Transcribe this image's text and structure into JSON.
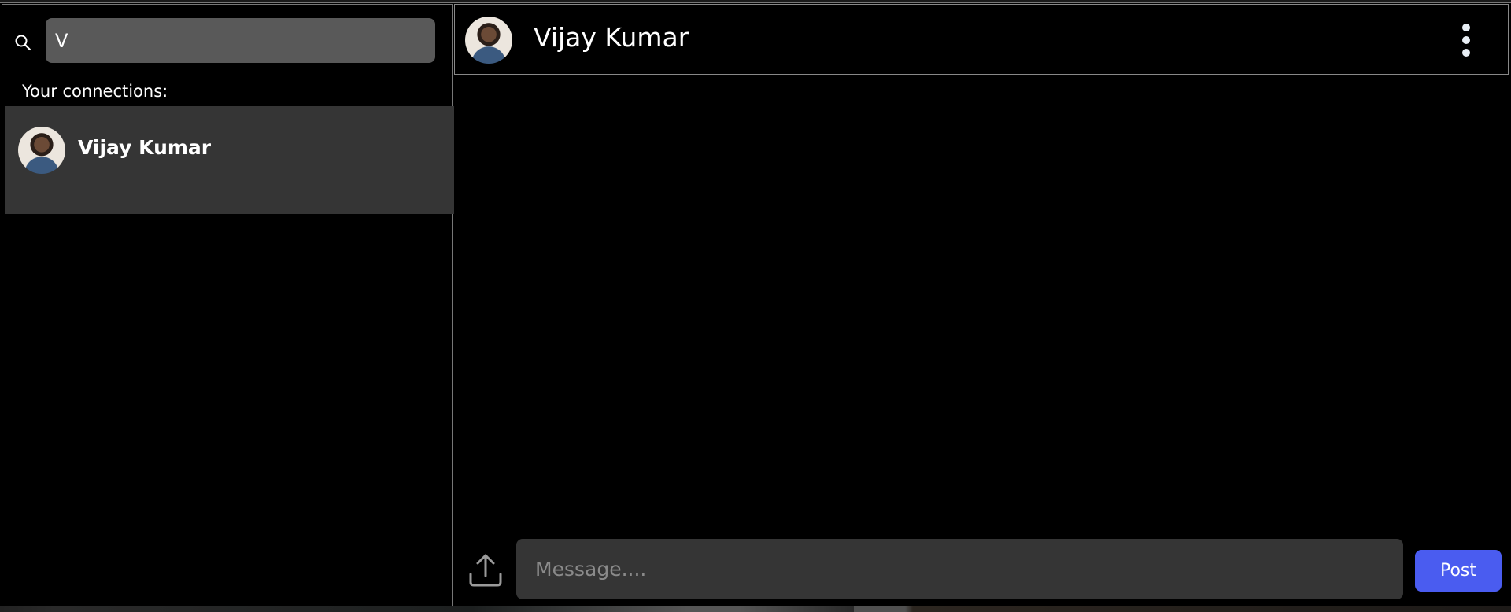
{
  "sidebar": {
    "search": {
      "value": "V",
      "icon": "search-icon"
    },
    "connections_label": "Your connections:",
    "connections": [
      {
        "name": "Vijay Kumar",
        "selected": true
      }
    ]
  },
  "chat": {
    "header": {
      "name": "Vijay Kumar",
      "menu_icon": "kebab-menu-icon"
    },
    "composer": {
      "placeholder": "Message....",
      "value": "",
      "upload_icon": "upload-icon",
      "post_label": "Post"
    }
  },
  "colors": {
    "accent": "#4a5cf0",
    "selected_row": "#353535",
    "input_bg": "#595959"
  }
}
